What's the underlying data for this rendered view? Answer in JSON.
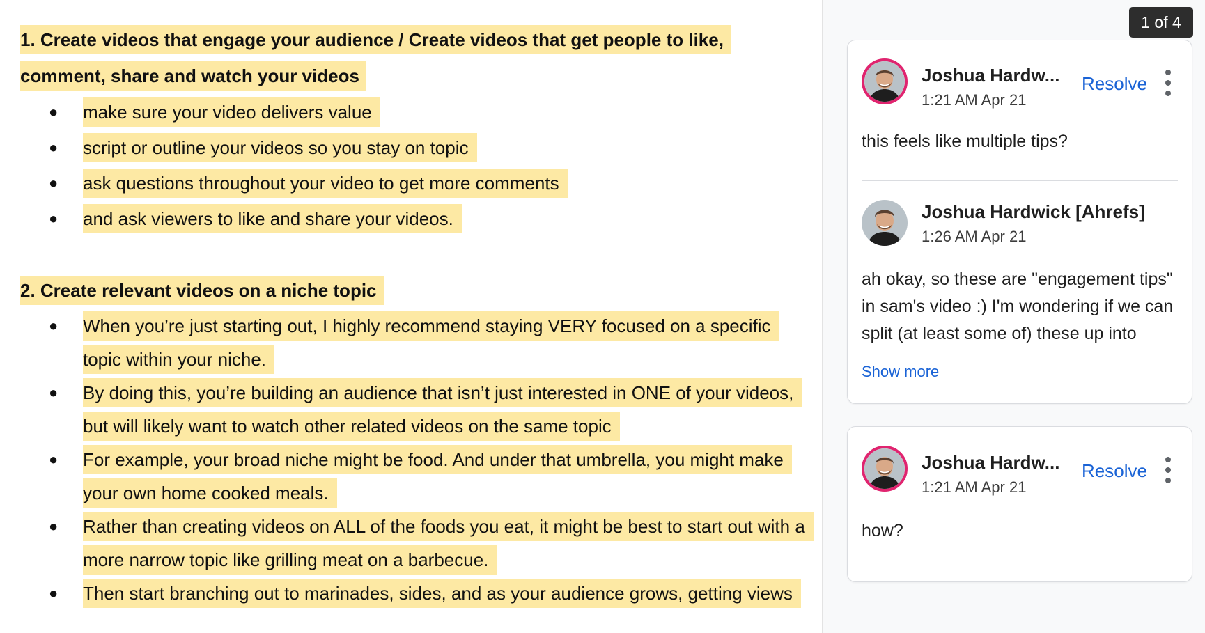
{
  "document": {
    "sections": [
      {
        "heading": "1. Create videos that engage your audience / Create videos that get people to like, comment, share and watch your videos",
        "bullets": [
          "make sure your video delivers value",
          "script or outline your videos so you stay on topic",
          "ask questions throughout your video to get more comments",
          "and ask viewers to like and share your videos."
        ]
      },
      {
        "heading": "2. Create relevant videos on a niche topic",
        "bullets": [
          "When you’re just starting out, I highly recommend staying VERY focused on a specific topic within your niche.",
          "By doing this, you’re building an audience that isn’t just interested in ONE of your videos, but will likely want to watch other related videos on the same topic",
          "For example, your broad niche might be food. And under that umbrella, you might make your own home cooked meals.",
          "Rather than creating videos on ALL of the foods you eat, it might be best to start out with a more narrow topic like grilling meat on a barbecue.",
          "Then start branching out to marinades, sides, and as your audience grows, getting views"
        ]
      }
    ],
    "bullet_glyph": "●",
    "highlight_color": "#fde9a4"
  },
  "sidebar": {
    "counter": "1 of 4",
    "threads": [
      {
        "author": "Joshua Hardw...",
        "time": "1:21 AM Apr 21",
        "resolve_label": "Resolve",
        "text": "this feels like multiple tips?",
        "reply": {
          "author": "Joshua Hardwick [Ahrefs]",
          "time": "1:26 AM Apr 21",
          "text": "ah okay, so these are \"engagement tips\" in sam's video :) I'm wondering if we can split (at least some of) these up into",
          "show_more": "Show more"
        }
      },
      {
        "author": "Joshua Hardw...",
        "time": "1:21 AM Apr 21",
        "resolve_label": "Resolve",
        "text": "how?"
      }
    ],
    "accent_color": "#1a63d6",
    "avatar_ring_color": "#e0246f"
  }
}
